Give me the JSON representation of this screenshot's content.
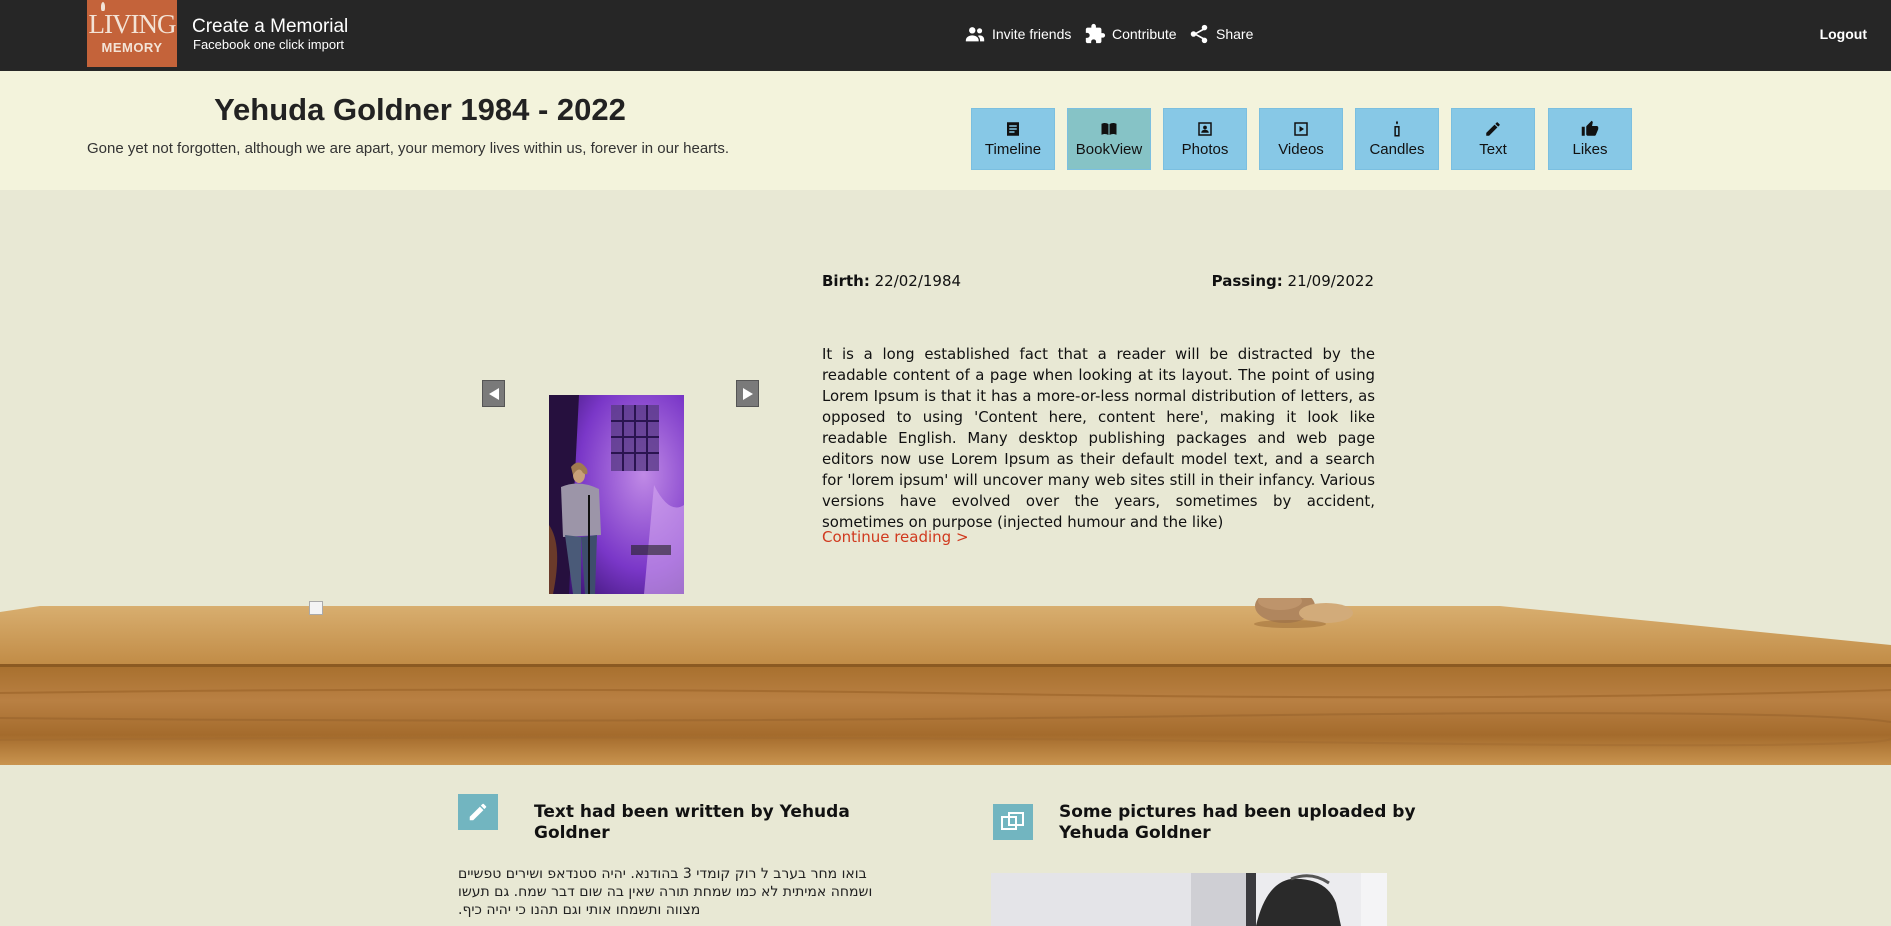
{
  "brand": {
    "logo_line1": "LIVING",
    "logo_line2": "MEMORY",
    "title": "Create a Memorial",
    "subtitle": "Facebook one click import"
  },
  "nav": {
    "invite": "Invite friends",
    "contribute": "Contribute",
    "share": "Share",
    "logout": "Logout"
  },
  "memorial": {
    "title": "Yehuda Goldner 1984 - 2022",
    "subtitle": "Gone yet not forgotten, although we are apart, your memory lives within us, forever in our hearts."
  },
  "views": [
    {
      "label": "Timeline",
      "icon": "timeline-icon"
    },
    {
      "label": "BookView",
      "icon": "book-icon",
      "active": true
    },
    {
      "label": "Photos",
      "icon": "photos-icon"
    },
    {
      "label": "Videos",
      "icon": "videos-icon"
    },
    {
      "label": "Candles",
      "icon": "candle-icon"
    },
    {
      "label": "Text",
      "icon": "pencil-icon"
    },
    {
      "label": "Likes",
      "icon": "thumbs-up-icon"
    }
  ],
  "book": {
    "birth_label": "Birth:",
    "birth_date": "22/02/1984",
    "passing_label": "Passing:",
    "passing_date": "21/09/2022",
    "bio": "It is a long established fact that a reader will be distracted by the readable content of a page when looking at its layout. The point of using Lorem Ipsum is that it has a more-or-less normal distribution of letters, as opposed to using 'Content here, content here', making it look like readable English. Many desktop publishing packages and web page editors now use Lorem Ipsum as their default model text, and a search for 'lorem ipsum' will uncover many web sites still in their infancy. Various versions have evolved over the years, sometimes by accident, sometimes on purpose (injected humour and the like)",
    "continue": "Continue reading >"
  },
  "activity": {
    "text_title": "Text had been written by Yehuda Goldner",
    "text_body": "בואו מחר בערב ל רוק קומדי 3 בהודנא. יהיה סטנדאפ ושירים טפשיים ושמחה אמיתית לא כמו שמחת תורה שאין בה שום דבר שמח. גם תעשו מצווה ותשמחו אותי וגם תהנו כי יהיה כיף.",
    "pictures_title": "Some pictures had been uploaded by Yehuda Goldner"
  },
  "colors": {
    "topbar": "#262626",
    "logo": "#c4633a",
    "view_button": "#87c8e6",
    "view_button_active": "#86c3c6",
    "link_accent": "#d0391e",
    "activity_icon": "#72b5c0"
  }
}
